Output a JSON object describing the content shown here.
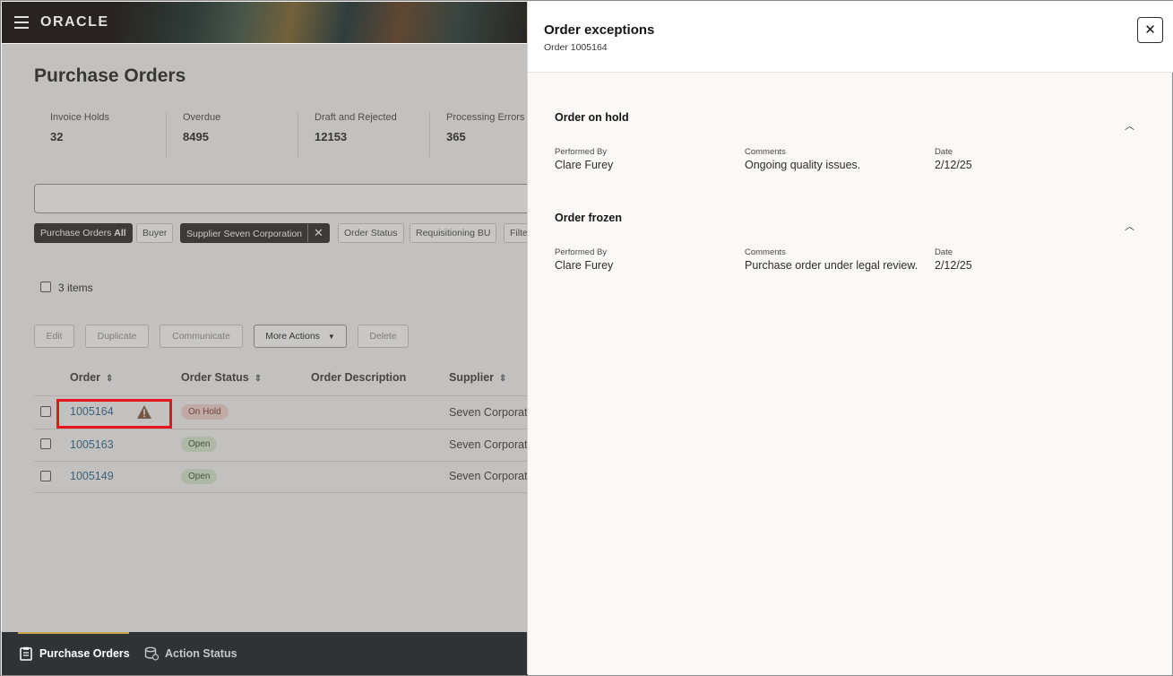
{
  "brand": "ORACLE",
  "page": {
    "title": "Purchase Orders"
  },
  "metrics": [
    {
      "label": "Invoice Holds",
      "value": "32"
    },
    {
      "label": "Overdue",
      "value": "8495"
    },
    {
      "label": "Draft and Rejected",
      "value": "12153"
    },
    {
      "label": "Processing Errors",
      "value": "365"
    }
  ],
  "filters": {
    "po_prefix": "Purchase Orders",
    "po_value": "All",
    "buyer": "Buyer",
    "supplier": "Supplier Seven Corporation",
    "order_status": "Order Status",
    "requisitioning_bu": "Requisitioning BU",
    "more": "Filte"
  },
  "list": {
    "items_count": "3 items"
  },
  "actions": {
    "edit": "Edit",
    "duplicate": "Duplicate",
    "communicate": "Communicate",
    "more_actions": "More Actions",
    "delete": "Delete"
  },
  "table": {
    "headers": {
      "order": "Order",
      "status": "Order Status",
      "description": "Order Description",
      "supplier": "Supplier"
    },
    "rows": [
      {
        "order": "1005164",
        "status": "On Hold",
        "description": "",
        "supplier": "Seven Corporation"
      },
      {
        "order": "1005163",
        "status": "Open",
        "description": "",
        "supplier": "Seven Corporation"
      },
      {
        "order": "1005149",
        "status": "Open",
        "description": "",
        "supplier": "Seven Corporation"
      }
    ]
  },
  "bottom_nav": {
    "purchase_orders": "Purchase Orders",
    "action_status": "Action Status"
  },
  "drawer": {
    "title": "Order exceptions",
    "subtitle": "Order 1005164",
    "sections": [
      {
        "title": "Order on hold",
        "performed_by_label": "Performed By",
        "performed_by": "Clare Furey",
        "comments_label": "Comments",
        "comments": "Ongoing quality issues.",
        "date_label": "Date",
        "date": "2/12/25"
      },
      {
        "title": "Order frozen",
        "performed_by_label": "Performed By",
        "performed_by": "Clare Furey",
        "comments_label": "Comments",
        "comments": "Purchase order under legal review.",
        "date_label": "Date",
        "date": "2/12/25"
      }
    ]
  },
  "colors": {
    "accent_red": "#e5141d",
    "link": "#1c5a83",
    "header_bg": "#2f2a26"
  }
}
